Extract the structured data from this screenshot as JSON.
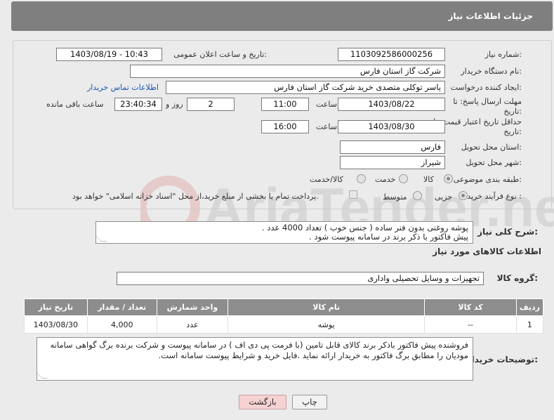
{
  "header": {
    "title": "جزئیات اطلاعات نیاز"
  },
  "need_number": {
    "label": "شماره نیاز:",
    "value": "1103092586000256"
  },
  "announce": {
    "label": "تاریخ و ساعت اعلان عمومی:",
    "value": "1403/08/19 - 10:43"
  },
  "buyer_org": {
    "label": "نام دستگاه خریدار:",
    "value": "شرکت گاز استان فارس"
  },
  "creator": {
    "label": "ایجاد کننده درخواست:",
    "value": "یاسر توکلی متصدی خرید شرکت گاز استان فارس",
    "contact_link": "اطلاعات تماس خریدار"
  },
  "deadline": {
    "label_line1": "مهلت ارسال پاسخ: تا",
    "label_line2": "تاریخ:",
    "date": "1403/08/22",
    "time_label": "ساعت",
    "time": "11:00",
    "days": "2",
    "days_label": "روز و",
    "remaining": "23:40:34",
    "remaining_label": "ساعت باقی مانده"
  },
  "validity": {
    "label_line1": "حداقل تاریخ اعتبار قیمت: تا",
    "label_line2": "تاریخ:",
    "date": "1403/08/30",
    "time_label": "ساعت",
    "time": "16:00"
  },
  "province": {
    "label": "استان محل تحویل:",
    "value": "فارس"
  },
  "city": {
    "label": "شهر محل تحویل:",
    "value": "شیراز"
  },
  "category": {
    "label": "طبقه بندی موضوعی:",
    "options": [
      "کالا",
      "خدمت",
      "کالا/خدمت"
    ],
    "selected": "کالا"
  },
  "process": {
    "label": "نوع فرآیند خرید :",
    "options": [
      "جزیی",
      "متوسط"
    ],
    "selected": "جزیی",
    "payment_note": "پرداخت تمام یا بخشی از مبلغ خرید،از محل \"اسناد خزانه اسلامی\" خواهد بود."
  },
  "description": {
    "label": "شرح کلی نیاز:",
    "line1": "پوشه روغنی بدون فنر ساده ( جنس خوب ) تعداد 4000 عدد .",
    "line2": "پیش فاکتور با ذکر برند در سامانه پیوست شود ."
  },
  "goods_info_title": "اطلاعات کالاهای مورد نیاز",
  "goods_group": {
    "label": "گروه کالا:",
    "value": "تجهیزات و وسایل تحصیلی واداری"
  },
  "goods_table": {
    "headers": [
      "ردیف",
      "کد کالا",
      "نام کالا",
      "واحد شمارش",
      "تعداد / مقدار",
      "تاریخ نیاز"
    ],
    "rows": [
      {
        "row": "1",
        "code": "--",
        "name": "پوشه",
        "unit": "عدد",
        "qty": "4,000",
        "date": "1403/08/30"
      }
    ]
  },
  "buyer_notes": {
    "label": "توضیحات خریدار:",
    "text": "فروشنده پیش فاکتور باذکر برند کالای قابل تامین (با فرمت پی دی اف ) در سامانه پیوست و شرکت برنده برگ گواهی سامانه مودیان را مطابق برگ فاکتور به خریدار ارائه نماید .فایل خرید و شرایط پیوست سامانه است."
  },
  "buttons": {
    "print": "چاپ",
    "back": "بازگشت"
  },
  "colors": {
    "header_bg": "#7f7f7f",
    "table_header_bg": "#8d8d8d",
    "link": "#1a55b7",
    "back_button_bg": "#f6d2d2"
  }
}
